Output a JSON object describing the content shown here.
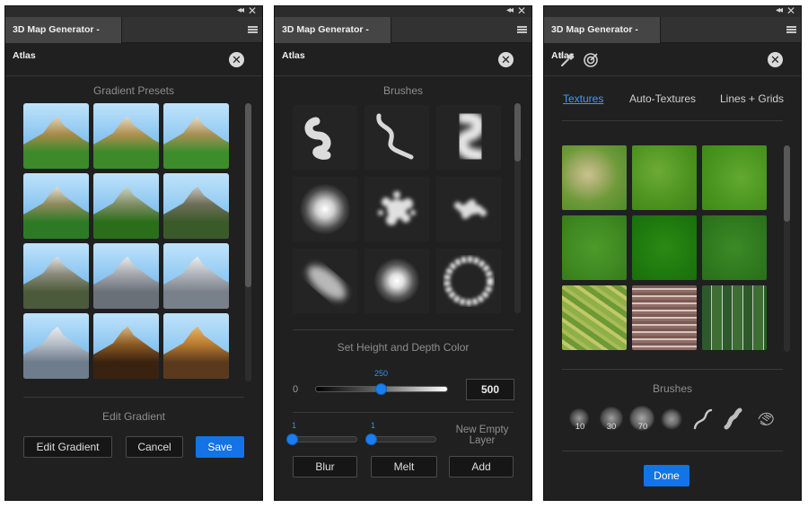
{
  "panels": [
    {
      "tab_title": "3D Map Generator - Atlas"
    },
    {
      "tab_title": "3D Map Generator - Atlas"
    },
    {
      "tab_title": "3D Map Generator - Atlas"
    }
  ],
  "topbar": {
    "collapse_glyph": "◂◂",
    "close_glyph": "✕"
  },
  "panel1": {
    "section_title": "Gradient Presets",
    "edit_label": "Edit Gradient",
    "buttons": {
      "edit": "Edit Gradient",
      "cancel": "Cancel",
      "save": "Save"
    }
  },
  "panel2": {
    "section_title": "Brushes",
    "height_title": "Set Height and Depth Color",
    "slider": {
      "min_label": "0",
      "value": "250",
      "max_value": "500",
      "fraction": 0.5
    },
    "small_slider_1": {
      "value": "1",
      "fraction": 0.0
    },
    "small_slider_2": {
      "value": "1",
      "fraction": 0.0
    },
    "new_layer_label": "New Empty Layer",
    "buttons": {
      "blur": "Blur",
      "melt": "Melt",
      "add": "Add"
    }
  },
  "panel3": {
    "tabs": {
      "textures": "Textures",
      "auto": "Auto-Textures",
      "lines": "Lines + Grids"
    },
    "brushes_title": "Brushes",
    "brush_sizes": [
      "10",
      "30",
      "70"
    ],
    "done": "Done"
  },
  "colors": {
    "accent": "#1473e6",
    "link": "#3f9aff",
    "panel_bg": "#202020"
  },
  "icons": [
    "eyedropper-icon",
    "target-icon",
    "close-icon",
    "menu-icon"
  ]
}
